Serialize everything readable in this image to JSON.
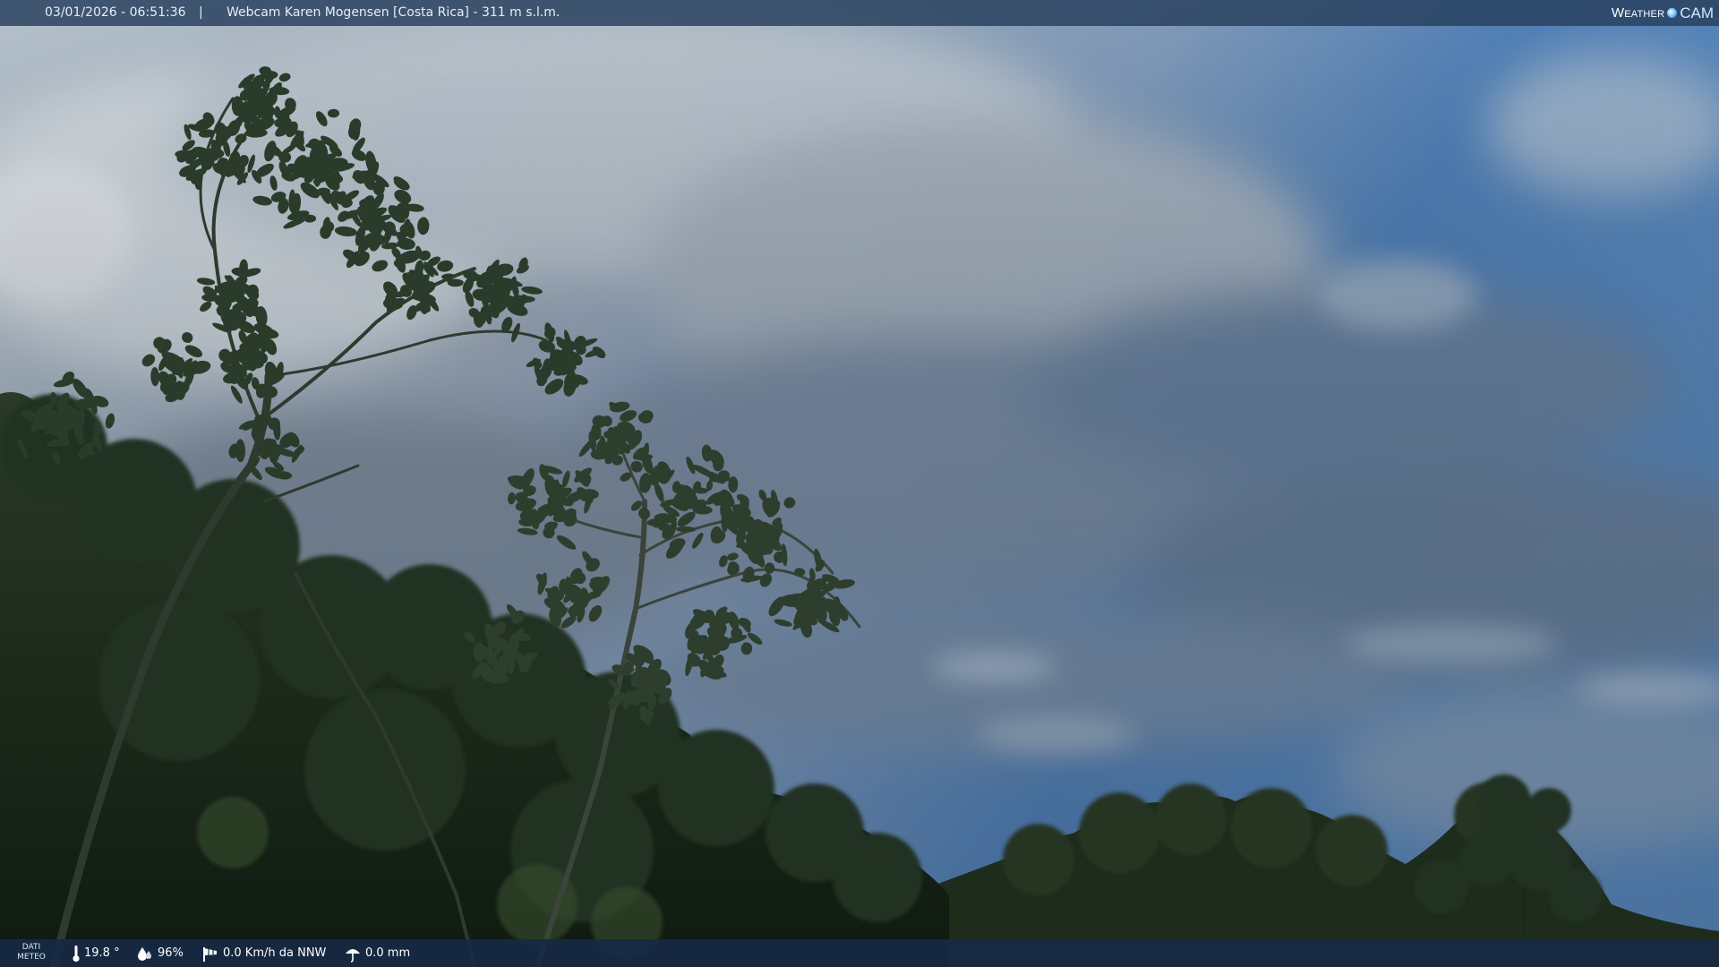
{
  "top_bar": {
    "timestamp": "03/01/2026 - 06:51:36",
    "separator": "|",
    "title": "Webcam Karen Mogensen [Costa Rica]  - 311 m s.l.m."
  },
  "logo": {
    "word": "Weather",
    "cam": "CAM"
  },
  "weather": {
    "label_line1": "DATI",
    "label_line2": "METEO",
    "temperature": "19.8 °",
    "humidity": "96%",
    "wind": "0.0 Km/h da NNW",
    "rain": "0.0 mm"
  },
  "icons": {
    "temperature": "thermometer-icon",
    "humidity": "humidity-drop-icon",
    "wind": "wind-sock-icon",
    "rain": "rain-umbrella-icon",
    "logo": "weathercam-globe-icon"
  },
  "colors": {
    "bar_top": "#263e5c",
    "bar_bottom": "#162a46",
    "sky_blue": "#4f7fb3",
    "cloud_grey": "#9aa6b4",
    "foliage_dark": "#1b2a1a"
  }
}
